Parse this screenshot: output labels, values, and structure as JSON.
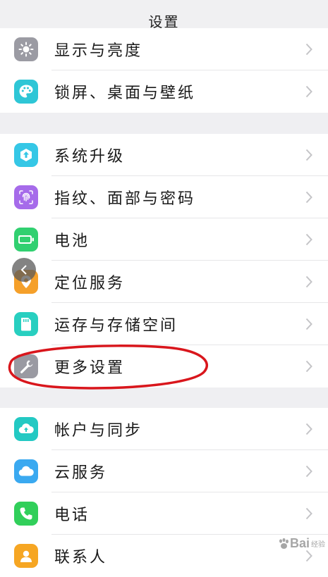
{
  "header": {
    "title": "设置"
  },
  "group1": [
    {
      "label": "显示与亮度",
      "icon": "sun-icon",
      "color": "#9b9ba3"
    },
    {
      "label": "锁屏、桌面与壁纸",
      "icon": "palette-icon",
      "color": "#2ec6d6"
    }
  ],
  "group2": [
    {
      "label": "系统升级",
      "icon": "upgrade-icon",
      "color": "#35c7e6"
    },
    {
      "label": "指纹、面部与密码",
      "icon": "fingerprint-icon",
      "color": "#a66bea"
    },
    {
      "label": "电池",
      "icon": "battery-icon",
      "color": "#31d070"
    },
    {
      "label": "定位服务",
      "icon": "location-icon",
      "color": "#f5a02a"
    },
    {
      "label": "运存与存储空间",
      "icon": "sd-card-icon",
      "color": "#28cfc0"
    },
    {
      "label": "更多设置",
      "icon": "wrench-icon",
      "color": "#9a9aa2"
    }
  ],
  "group3": [
    {
      "label": "帐户与同步",
      "icon": "cloud-sync-icon",
      "color": "#23c9c3"
    },
    {
      "label": "云服务",
      "icon": "cloud-icon",
      "color": "#3aa9f0"
    },
    {
      "label": "电话",
      "icon": "phone-icon",
      "color": "#31cf5a"
    },
    {
      "label": "联系人",
      "icon": "contacts-icon",
      "color": "#f6a623"
    }
  ],
  "annotation_color": "#d9161c",
  "watermark": {
    "text": "Bai",
    "sub": "经验"
  }
}
